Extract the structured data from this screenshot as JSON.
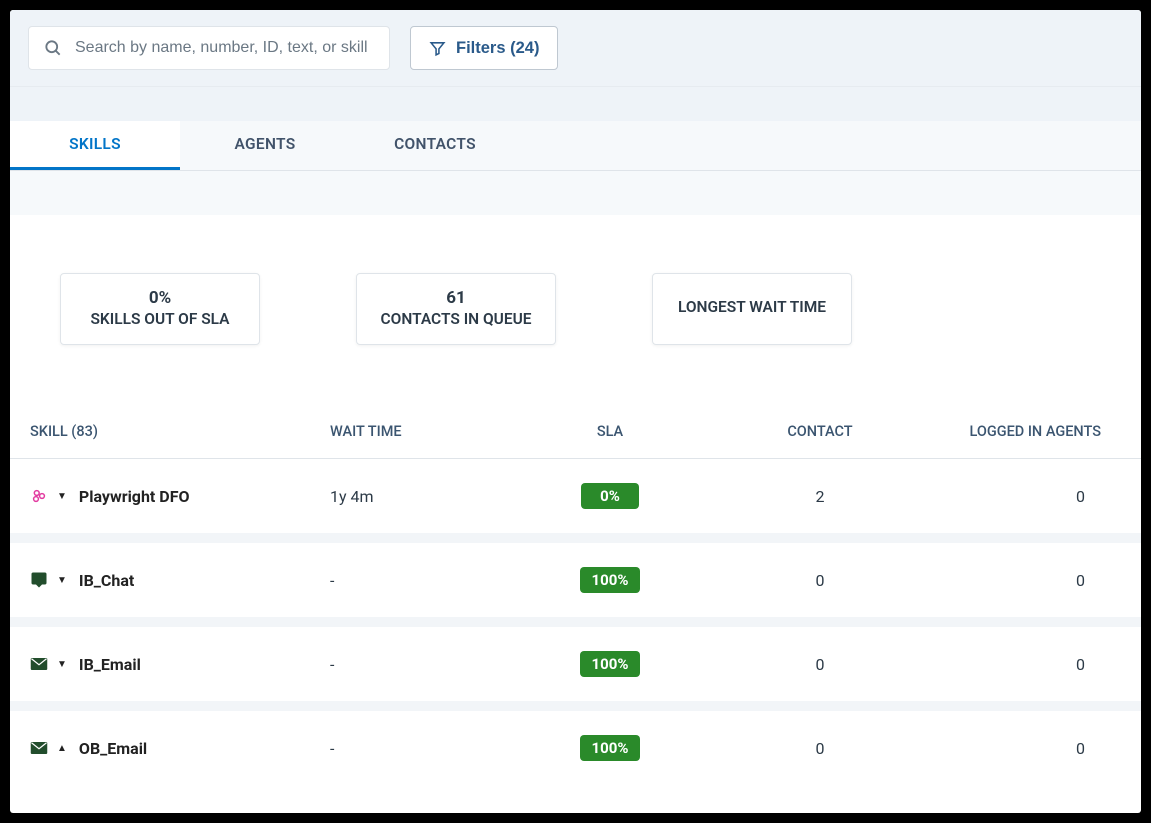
{
  "search": {
    "placeholder": "Search by name, number, ID, text, or skill"
  },
  "filters": {
    "label": "Filters (24)"
  },
  "tabs": {
    "skills": "SKILLS",
    "agents": "AGENTS",
    "contacts": "CONTACTS"
  },
  "metrics": {
    "sla_out_value": "0%",
    "sla_out_label": "SKILLS OUT OF SLA",
    "queue_value": "61",
    "queue_label": "CONTACTS IN QUEUE",
    "longest_wait_label": "LONGEST WAIT TIME"
  },
  "headers": {
    "skill": "SKILL (83)",
    "wait": "WAIT TIME",
    "sla": "SLA",
    "contact": "CONTACT",
    "agents": "LOGGED IN AGENTS"
  },
  "rows": [
    {
      "icon": "chat-dfo",
      "direction": "down",
      "name": "Playwright DFO",
      "wait": "1y 4m",
      "sla": "0%",
      "contact": "2",
      "agents": "0"
    },
    {
      "icon": "chat-bubble",
      "direction": "down",
      "name": "IB_Chat",
      "wait": "-",
      "sla": "100%",
      "contact": "0",
      "agents": "0"
    },
    {
      "icon": "email",
      "direction": "down",
      "name": "IB_Email",
      "wait": "-",
      "sla": "100%",
      "contact": "0",
      "agents": "0"
    },
    {
      "icon": "email",
      "direction": "up",
      "name": "OB_Email",
      "wait": "-",
      "sla": "100%",
      "contact": "0",
      "agents": "0"
    }
  ]
}
